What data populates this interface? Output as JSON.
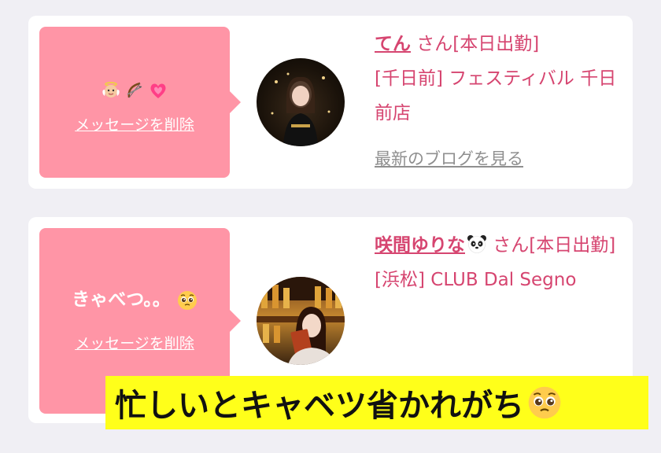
{
  "messages": [
    {
      "message_text": "",
      "message_icons": [
        "baby-angel-icon",
        "bow-arrow-icon",
        "growing-heart-icon"
      ],
      "delete_label": "メッセージを削除",
      "name": "てん",
      "suffix": " さん[本日出勤]",
      "shop": "[千日前] フェスティバル 千日前店",
      "blog_link": "最新のブログを見る"
    },
    {
      "message_text": "きゃべつ。。",
      "message_icons": [
        "pleading-face-icon"
      ],
      "delete_label": "メッセージを削除",
      "name": "咲間ゆりな",
      "name_icon": "panda-icon",
      "suffix": " さん[本日出勤]",
      "shop": "[浜松] CLUB Dal Segno"
    }
  ],
  "caption": {
    "text": "忙しいとキャベツ省かれがち",
    "icon": "pleading-face-icon"
  },
  "colors": {
    "bubble": "#ff95a6",
    "accent": "#d64570",
    "caption_bg": "#ffff1a",
    "link_gray": "#8f8f8f"
  }
}
